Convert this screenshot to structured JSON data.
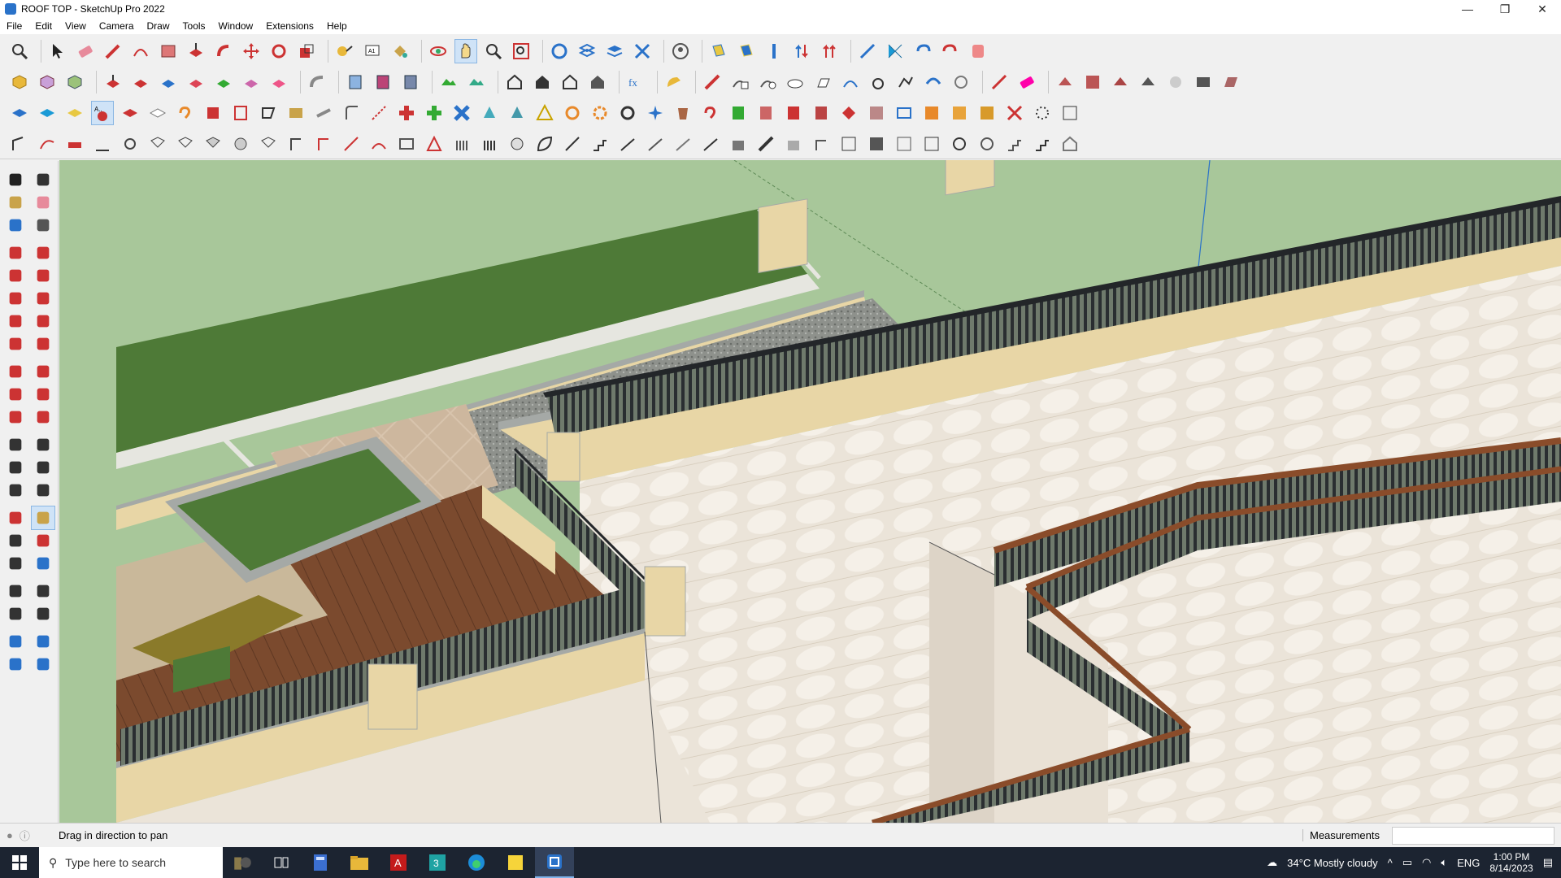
{
  "window": {
    "title": "ROOF TOP - SketchUp Pro 2022",
    "min": "—",
    "max": "❐",
    "close": "✕"
  },
  "menu": [
    "File",
    "Edit",
    "View",
    "Camera",
    "Draw",
    "Tools",
    "Window",
    "Extensions",
    "Help"
  ],
  "status": {
    "hint": "Drag in direction to pan",
    "measurements_label": "Measurements",
    "measurements_value": ""
  },
  "taskbar": {
    "search_placeholder": "Type here to search",
    "weather": "34°C  Mostly cloudy",
    "lang": "ENG",
    "time": "1:00 PM",
    "date": "8/14/2023"
  },
  "colors": {
    "sky": "#a8c79a",
    "wall": "#e9e2d7",
    "parapet": "#e9d7a8",
    "railing": "#2f3337",
    "wood": "#7b4a2e",
    "grass": "#4e7a37",
    "accent": "#2a72c9"
  },
  "icons": {
    "toolbar_row1": [
      "zoom-icon",
      "select-icon",
      "eraser-icon",
      "pencil-icon",
      "arc-icon",
      "rectangle-icon",
      "push-pull-icon",
      "follow-me-icon",
      "move-icon",
      "rotate-icon",
      "scale-icon",
      "tape-icon",
      "text-icon",
      "paint-icon",
      "orbit-icon",
      "pan-icon",
      "zoom-window-icon",
      "zoom-extents-icon",
      "warehouse-icon",
      "components-icon",
      "layers-icon",
      "styles-icon",
      "profile-icon",
      "section-icon",
      "display-section-icon",
      "axes-icon",
      "push-up-icon",
      "push-down-icon",
      "dimension-icon",
      "xray-icon",
      "undo-icon",
      "redo-icon",
      "extension-icon"
    ],
    "left_tools": [
      "select-icon",
      "lasso-icon",
      "paint-icon",
      "eraser-icon",
      "component-icon",
      "tag-icon",
      "line-icon",
      "freehand-icon",
      "rectangle-icon",
      "rotated-rect-icon",
      "circle-icon",
      "polygon-icon",
      "arc-icon",
      "pie-icon",
      "two-point-arc-icon",
      "three-point-arc-icon",
      "move-icon",
      "push-pull-icon",
      "rotate-icon",
      "follow-me-icon",
      "scale-icon",
      "offset-icon",
      "tape-icon",
      "dimension-icon",
      "protractor-icon",
      "text-icon",
      "axes-icon",
      "3d-text-icon",
      "orbit-icon",
      "pan-icon",
      "zoom-icon",
      "zoom-window-icon",
      "zoom-extents-icon",
      "previous-icon",
      "position-camera-icon",
      "look-around-icon",
      "walk-icon",
      "section-icon",
      "warehouse-icon",
      "extension-icon",
      "layers-icon",
      "styles-icon"
    ]
  }
}
